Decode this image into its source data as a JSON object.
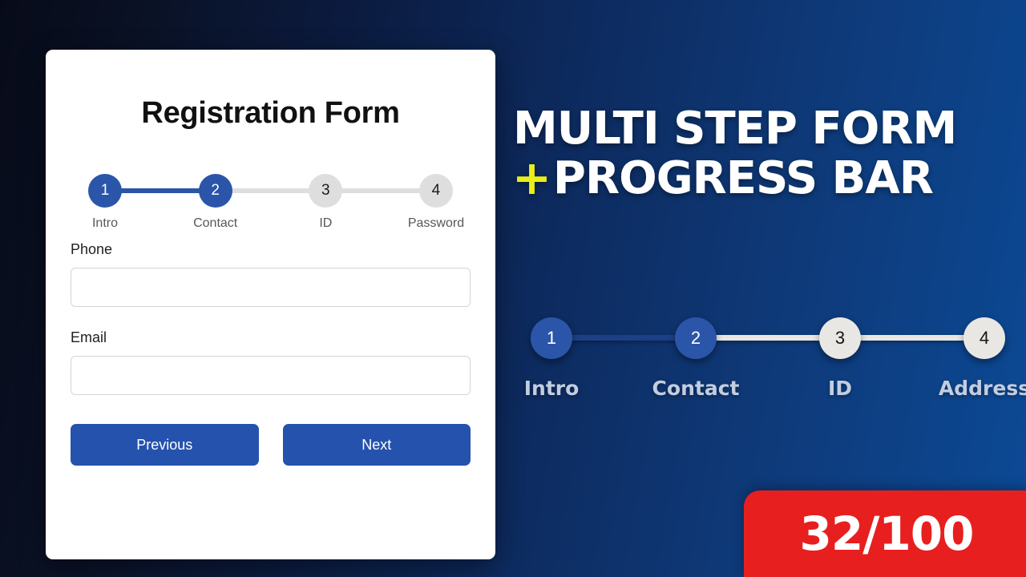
{
  "theme": {
    "accent_blue": "#2b55a9",
    "button_blue": "#2552ad",
    "inactive_gray": "#dedede",
    "badge_red": "#e81f1f",
    "plus_yellow": "#eaee18",
    "promo_label": "#c3cde0"
  },
  "card": {
    "title": "Registration Form",
    "stepper": {
      "current_step": 2,
      "total_steps": 4,
      "steps": [
        {
          "number": "1",
          "label": "Intro",
          "state": "active"
        },
        {
          "number": "2",
          "label": "Contact",
          "state": "active"
        },
        {
          "number": "3",
          "label": "ID",
          "state": "inactive"
        },
        {
          "number": "4",
          "label": "Password",
          "state": "inactive"
        }
      ]
    },
    "fields": [
      {
        "label": "Phone",
        "value": "",
        "placeholder": ""
      },
      {
        "label": "Email",
        "value": "",
        "placeholder": ""
      }
    ],
    "buttons": {
      "previous": "Previous",
      "next": "Next"
    }
  },
  "promo": {
    "heading_line1": "MULTI STEP FORM",
    "plus_symbol": "+",
    "heading_line2": "PROGRESS BAR",
    "stepper": {
      "current_step": 2,
      "total_steps": 4,
      "steps": [
        {
          "number": "1",
          "label": "Intro",
          "state": "active"
        },
        {
          "number": "2",
          "label": "Contact",
          "state": "active"
        },
        {
          "number": "3",
          "label": "ID",
          "state": "inactive"
        },
        {
          "number": "4",
          "label": "Address",
          "state": "inactive"
        }
      ]
    },
    "score_badge": "32/100"
  }
}
